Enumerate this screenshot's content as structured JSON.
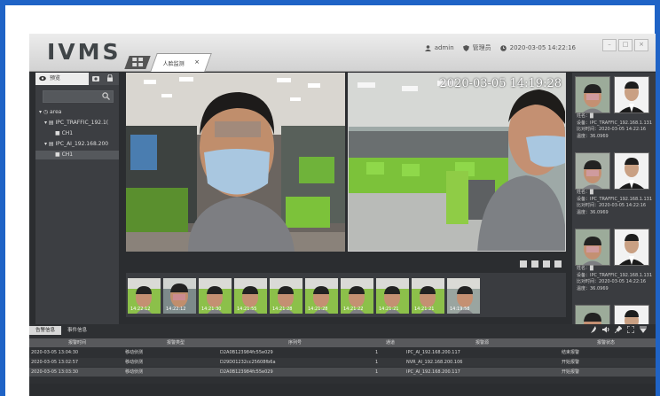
{
  "app": {
    "logo": "IVMS",
    "tab_label": "人脸监测",
    "tab_close": "×",
    "user": "admin",
    "role": "管理员",
    "datetime": "2020-03-05 14:22:16",
    "window_controls": [
      "–",
      "□",
      "×"
    ]
  },
  "left_panel": {
    "tab_label": "预览",
    "search_placeholder": "",
    "tree": [
      {
        "label": "▾ ◷ area",
        "level": 0
      },
      {
        "label": "▾ ▤ IPC_TRAFFIC_192.1(",
        "level": 1
      },
      {
        "label": "■ CH1",
        "level": 2
      },
      {
        "label": "▾ ▤ IPC_AI_192.168.200",
        "level": 1
      },
      {
        "label": "■ CH1",
        "level": 2,
        "selected": true
      }
    ]
  },
  "video": {
    "osd_timestamp": "2020-03-05 14:19:28"
  },
  "thumbnails": [
    "14:22:12",
    "14:22:12",
    "14:21:30",
    "14:21:55",
    "14:21:28",
    "14:21:28",
    "14:21:22",
    "14:21:21",
    "14:21:21",
    "14:19:58"
  ],
  "captures": [
    {
      "name": "姓名：█",
      "device": "设备：IPC_TRAFFIC_192.168.1.131",
      "time": "比对时间：2020-03-05 14:22:16",
      "temp": "温度：36.0969"
    },
    {
      "name": "姓名：█",
      "device": "设备：IPC_TRAFFIC_192.168.1.131",
      "time": "比对时间：2020-03-05 14:22:16",
      "temp": "温度：36.0969"
    },
    {
      "name": "姓名：█",
      "device": "设备：IPC_TRAFFIC_192.168.1.131",
      "time": "比对时间：2020-03-05 14:22:16",
      "temp": "温度：36.0969"
    }
  ],
  "bottom": {
    "tabs": [
      "告警信息",
      "事件信息"
    ],
    "columns": [
      "报警时间",
      "报警类型",
      "序列号",
      "通道",
      "报警源",
      "报警状态"
    ],
    "rows": [
      [
        "2020-03-05 13:04:30",
        "移动侦测",
        "D2A0B123984fc55e029",
        "1",
        "IPC_AI_192.168.200.117",
        "结束报警"
      ],
      [
        "2020-03-05 13:02:57",
        "移动侦测",
        "D29D01232cc25608fb6a",
        "1",
        "NVR_AI_192.168.200.106",
        "开始报警"
      ],
      [
        "2020-03-05 13:03:30",
        "移动侦测",
        "D2A0B123984fc55e029",
        "1",
        "IPC_AI_192.168.200.117",
        "开始报警"
      ]
    ]
  },
  "colors": {
    "frame_border": "#1f63c6",
    "app_bg": "#2b2d30",
    "panel_bg": "#3a3c40",
    "office_green": "#7cc23a"
  }
}
